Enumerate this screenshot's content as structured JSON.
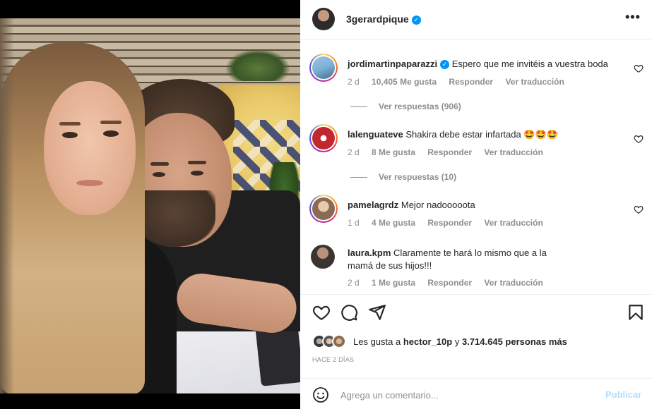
{
  "header": {
    "username": "3gerardpique",
    "more_label": "•••"
  },
  "comments": [
    {
      "username": "jordimartinpaparazzi",
      "verified": true,
      "text": "Espero que me invitéis a vuestra boda",
      "time": "2 d",
      "likes": "10,405 Me gusta",
      "reply": "Responder",
      "translate": "Ver traducción",
      "view_replies": "Ver respuestas (906)"
    },
    {
      "username": "lalenguateve",
      "verified": false,
      "text": "Shakira debe estar infartada 🤩🤩🤩",
      "time": "2 d",
      "likes": "8 Me gusta",
      "reply": "Responder",
      "translate": "Ver traducción",
      "view_replies": "Ver respuestas (10)"
    },
    {
      "username": "pamelagrdz",
      "verified": false,
      "text": "Mejor nadooooota",
      "time": "1 d",
      "likes": "4 Me gusta",
      "reply": "Responder",
      "translate": "Ver traducción"
    },
    {
      "username": "laura.kpm",
      "verified": false,
      "text": "Claramente te hará lo mismo que a la mamá de sus hijos!!!",
      "time": "2 d",
      "likes": "1 Me gusta",
      "reply": "Responder",
      "translate": "Ver traducción"
    }
  ],
  "likes": {
    "prefix": "Les gusta a",
    "user": "hector_10p",
    "connector": "y",
    "count": "3.714.645 personas más"
  },
  "timestamp": "HACE 2 DÍAS",
  "add_comment": {
    "placeholder": "Agrega un comentario...",
    "publish_label": "Publicar"
  },
  "colors": {
    "link_blue": "#0095f6",
    "disabled_blue": "#b2dffc",
    "secondary_text": "#8e8e8e",
    "primary_text": "#262626"
  },
  "icons": [
    "more-icon",
    "heart-icon",
    "comment-icon",
    "share-icon",
    "bookmark-icon",
    "emoji-icon",
    "verified-icon"
  ]
}
